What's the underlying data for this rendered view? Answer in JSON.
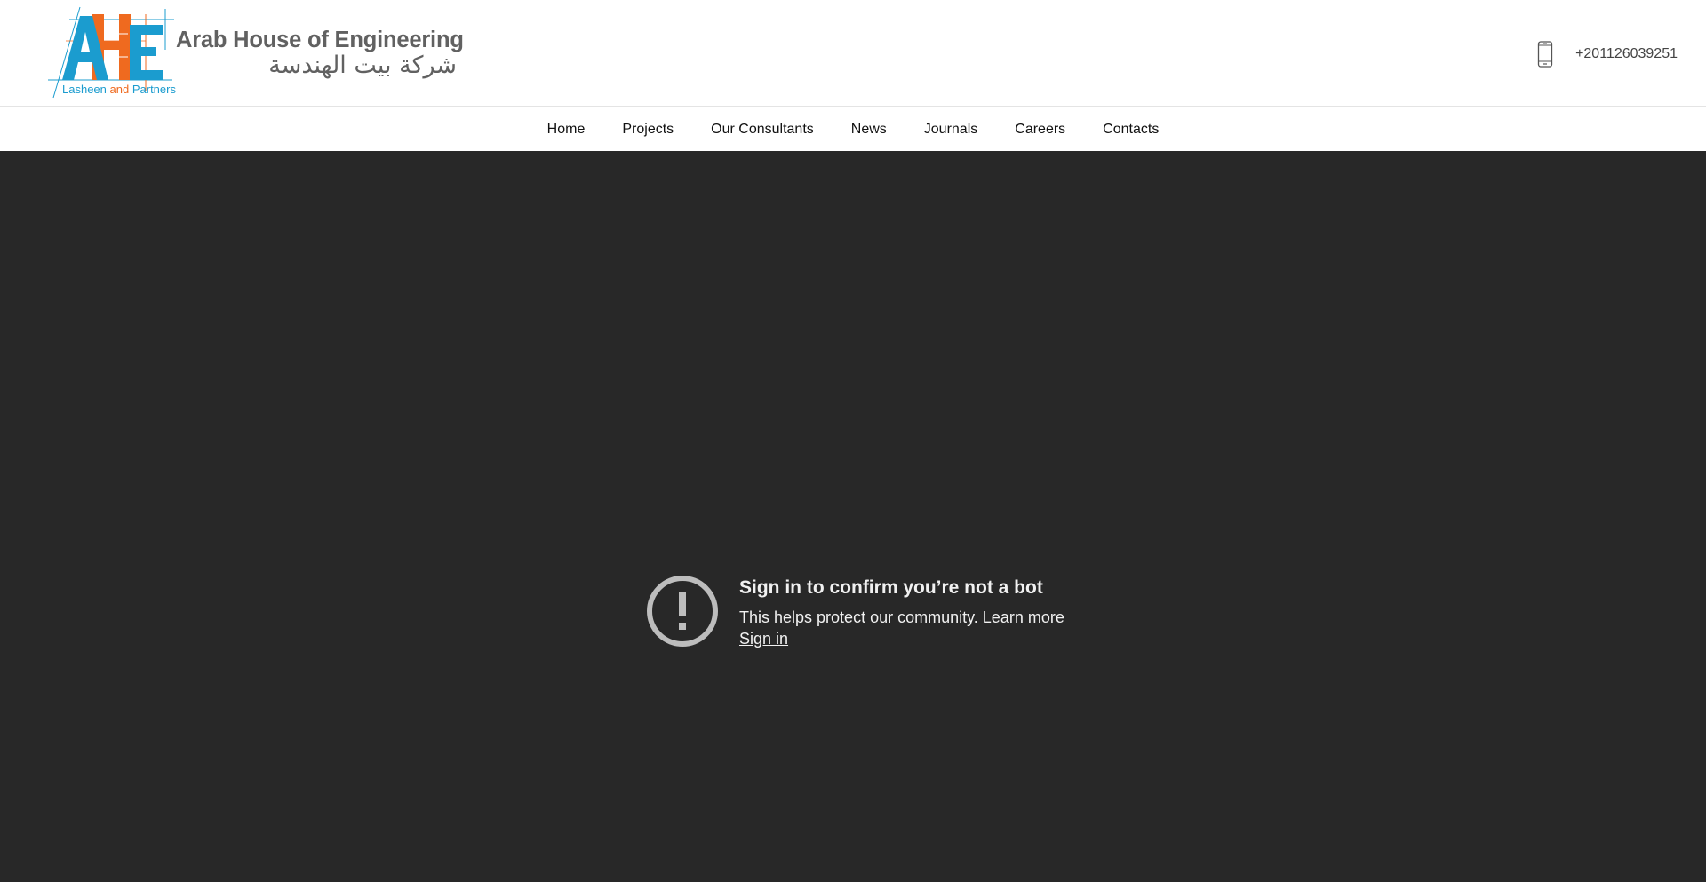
{
  "header": {
    "logo": {
      "monogram": "AHE",
      "name_en": "Arab House of Engineering",
      "name_ar": "شركة بيت الهندسة",
      "subtitle_part1": "Lasheen",
      "subtitle_part2": "and",
      "subtitle_part3": "Partners",
      "colors": {
        "blue": "#1b9ccf",
        "orange": "#ef6a1f",
        "text": "#616161"
      }
    },
    "phone": {
      "icon": "mobile-phone-icon",
      "number": "+201126039251"
    }
  },
  "nav": {
    "items": [
      {
        "label": "Home"
      },
      {
        "label": "Projects"
      },
      {
        "label": "Our Consultants"
      },
      {
        "label": "News"
      },
      {
        "label": "Journals"
      },
      {
        "label": "Careers"
      },
      {
        "label": "Contacts"
      }
    ]
  },
  "video": {
    "background": "#282828",
    "notice": {
      "icon": "exclamation-circle-icon",
      "title": "Sign in to confirm you’re not a bot",
      "body": "This helps protect our community.",
      "learn_more": "Learn more",
      "sign_in": "Sign in"
    }
  }
}
